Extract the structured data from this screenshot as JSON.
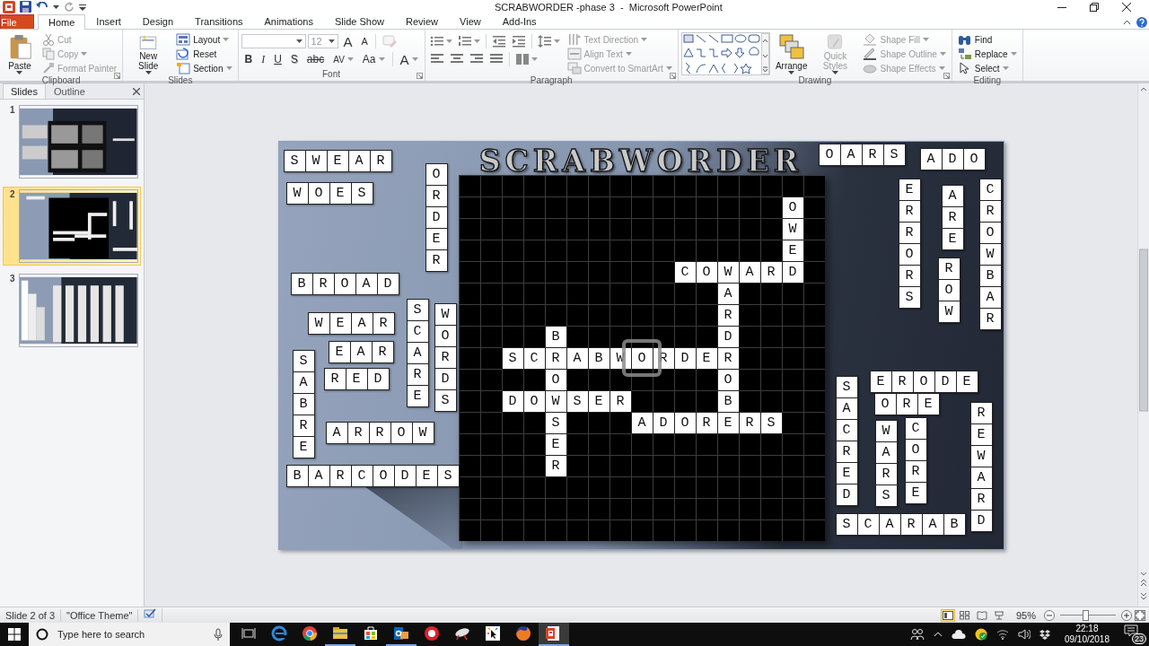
{
  "window": {
    "title": "SCRABWORDER -phase 3  -  Microsoft PowerPoint"
  },
  "ribbon_tabs": [
    {
      "label": "File",
      "kind": "file",
      "selected": false
    },
    {
      "label": "Home",
      "kind": "tab",
      "selected": true
    },
    {
      "label": "Insert",
      "kind": "tab",
      "selected": false
    },
    {
      "label": "Design",
      "kind": "tab",
      "selected": false
    },
    {
      "label": "Transitions",
      "kind": "tab",
      "selected": false
    },
    {
      "label": "Animations",
      "kind": "tab",
      "selected": false
    },
    {
      "label": "Slide Show",
      "kind": "tab",
      "selected": false
    },
    {
      "label": "Review",
      "kind": "tab",
      "selected": false
    },
    {
      "label": "View",
      "kind": "tab",
      "selected": false
    },
    {
      "label": "Add-Ins",
      "kind": "tab",
      "selected": false
    }
  ],
  "ribbon_groups": [
    {
      "label": "Clipboard",
      "items": [
        {
          "kind": "large",
          "label": "Paste",
          "menu": true,
          "disabled": false
        },
        {
          "kind": "small",
          "label": "Cut",
          "menu": false,
          "disabled": true
        },
        {
          "kind": "small",
          "label": "Copy",
          "menu": true,
          "disabled": true
        },
        {
          "kind": "small",
          "label": "Format Painter",
          "menu": false,
          "disabled": true
        }
      ]
    },
    {
      "label": "Slides",
      "items": [
        {
          "kind": "large",
          "label": "New Slide",
          "menu": true,
          "disabled": false
        },
        {
          "kind": "small",
          "label": "Layout",
          "menu": true,
          "disabled": false
        },
        {
          "kind": "small",
          "label": "Reset",
          "menu": false,
          "disabled": false
        },
        {
          "kind": "small",
          "label": "Section",
          "menu": true,
          "disabled": false
        }
      ]
    },
    {
      "label": "Font",
      "items": [
        {
          "kind": "field",
          "value": "12",
          "menu": true,
          "disabled": true
        },
        {
          "kind": "glyph",
          "label": "A",
          "menu": false,
          "disabled": false
        },
        {
          "kind": "glyph",
          "label": "A",
          "menu": false,
          "disabled": false
        },
        {
          "kind": "icon",
          "menu": false,
          "disabled": true
        },
        {
          "kind": "glyph",
          "label": "B",
          "menu": false,
          "disabled": false
        },
        {
          "kind": "glyph",
          "label": "I",
          "menu": false,
          "disabled": false
        },
        {
          "kind": "glyph",
          "label": "U",
          "menu": false,
          "disabled": false
        },
        {
          "kind": "glyph",
          "label": "S",
          "menu": false,
          "disabled": false
        },
        {
          "kind": "glyph",
          "label": "abc",
          "menu": false,
          "disabled": false
        },
        {
          "kind": "glyph",
          "label": "AV",
          "menu": true,
          "disabled": false
        },
        {
          "kind": "glyph",
          "label": "Aa",
          "menu": true,
          "disabled": false
        },
        {
          "kind": "glyph",
          "label": "A",
          "menu": true,
          "disabled": false
        }
      ]
    },
    {
      "label": "Paragraph",
      "items": [
        {
          "kind": "icon",
          "menu": true,
          "disabled": false
        },
        {
          "kind": "icon",
          "menu": true,
          "disabled": false
        },
        {
          "kind": "icon",
          "menu": false,
          "disabled": false
        },
        {
          "kind": "icon",
          "menu": false,
          "disabled": false
        },
        {
          "kind": "icon",
          "menu": true,
          "disabled": false
        },
        {
          "kind": "icon",
          "menu": false,
          "disabled": false
        },
        {
          "kind": "icon",
          "menu": false,
          "disabled": false
        },
        {
          "kind": "icon",
          "menu": false,
          "disabled": false
        },
        {
          "kind": "icon",
          "menu": false,
          "disabled": false
        },
        {
          "kind": "icon",
          "menu": true,
          "disabled": false
        },
        {
          "kind": "small",
          "label": "Text Direction",
          "menu": true,
          "disabled": true
        },
        {
          "kind": "small",
          "label": "Align Text",
          "menu": true,
          "disabled": true
        },
        {
          "kind": "small",
          "label": "Convert to SmartArt",
          "menu": true,
          "disabled": true
        }
      ]
    },
    {
      "label": "Drawing",
      "items": [
        {
          "kind": "large",
          "label": "Arrange",
          "menu": true,
          "disabled": false
        },
        {
          "kind": "large",
          "label": "Quick Styles",
          "menu": true,
          "disabled": true
        },
        {
          "kind": "small",
          "label": "Shape Fill",
          "menu": true,
          "disabled": true
        },
        {
          "kind": "small",
          "label": "Shape Outline",
          "menu": true,
          "disabled": true
        },
        {
          "kind": "small",
          "label": "Shape Effects",
          "menu": true,
          "disabled": true
        }
      ]
    },
    {
      "label": "Editing",
      "items": [
        {
          "kind": "small",
          "label": "Find",
          "menu": false,
          "disabled": false
        },
        {
          "kind": "small",
          "label": "Replace",
          "menu": true,
          "disabled": false
        },
        {
          "kind": "small",
          "label": "Select",
          "menu": true,
          "disabled": false
        }
      ]
    }
  ],
  "pane_tabs": [
    {
      "label": "Slides",
      "selected": true
    },
    {
      "label": "Outline",
      "selected": false
    }
  ],
  "thumbnails": [
    {
      "number": "1",
      "selected": false
    },
    {
      "number": "2",
      "selected": true
    },
    {
      "number": "3",
      "selected": false
    }
  ],
  "slide": {
    "title": "SCRABWORDER",
    "board": {
      "rows": [
        "                 ",
        "               O ",
        "               W ",
        "               E ",
        "          COWARD ",
        "            A    ",
        "            R    ",
        "    B       D    ",
        "  SCRABWORDER    ",
        "    O       O    ",
        "  DOWSER    B    ",
        "    S   ADORERS  ",
        "    E            ",
        "    R            ",
        "                 ",
        "                 ",
        "                 "
      ]
    },
    "tiles": [
      {
        "word": "SWEAR",
        "kind": "across"
      },
      {
        "word": "WOES",
        "kind": "across"
      },
      {
        "word": "ORDER",
        "kind": "down"
      },
      {
        "word": "BROAD",
        "kind": "across"
      },
      {
        "word": "WEAR",
        "kind": "across"
      },
      {
        "word": "SABRE",
        "kind": "down"
      },
      {
        "word": "EAR",
        "kind": "across"
      },
      {
        "word": "RED",
        "kind": "across"
      },
      {
        "word": "SCARE",
        "kind": "down"
      },
      {
        "word": "WORDS",
        "kind": "down"
      },
      {
        "word": "ARROW",
        "kind": "across"
      },
      {
        "word": "BARCODES",
        "kind": "across"
      },
      {
        "word": "OARS",
        "kind": "across"
      },
      {
        "word": "ADO",
        "kind": "across"
      },
      {
        "word": "ERRORS",
        "kind": "down"
      },
      {
        "word": "ARE",
        "kind": "down"
      },
      {
        "word": "ROW",
        "kind": "down"
      },
      {
        "word": "CROWBAR",
        "kind": "down"
      },
      {
        "word": "SACRED",
        "kind": "down"
      },
      {
        "word": "ERODE",
        "kind": "across"
      },
      {
        "word": "ORE",
        "kind": "across"
      },
      {
        "word": "WARS",
        "kind": "down"
      },
      {
        "word": "CORE",
        "kind": "down"
      },
      {
        "word": "REWARD",
        "kind": "down"
      },
      {
        "word": "SCARAB",
        "kind": "across"
      }
    ]
  },
  "status_bar": {
    "slide": "Slide 2 of 3",
    "theme": "\"Office Theme\"",
    "views": [
      {
        "selected": true
      },
      {
        "selected": false
      },
      {
        "selected": false
      },
      {
        "selected": false
      }
    ],
    "zoom": "95%",
    "zoom_slider": {
      "level": 0.45
    }
  },
  "taskbar": {
    "search_placeholder": "Type here to search",
    "apps": [
      {
        "running": false,
        "selected": false
      },
      {
        "running": false,
        "selected": false
      },
      {
        "running": false,
        "selected": false
      },
      {
        "running": true,
        "selected": false
      },
      {
        "running": false,
        "selected": false
      },
      {
        "running": true,
        "selected": false
      },
      {
        "running": false,
        "selected": false
      },
      {
        "running": false,
        "selected": false
      },
      {
        "running": false,
        "selected": false
      },
      {
        "running": false,
        "selected": false
      },
      {
        "running": true,
        "selected": true
      }
    ],
    "time": "22:18",
    "date": "09/10/2018",
    "notifications": "23"
  }
}
